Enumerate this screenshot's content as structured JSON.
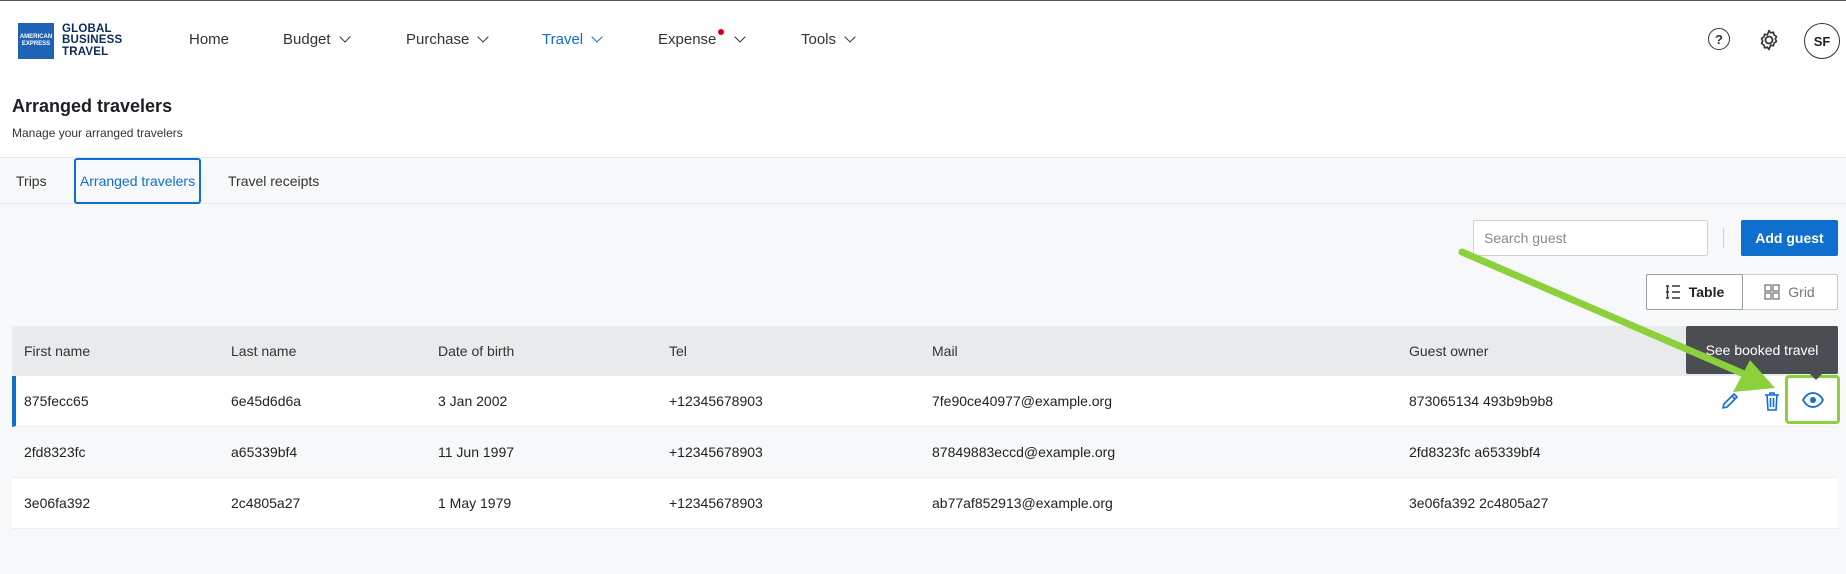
{
  "logo": {
    "badge": "AMERICAN EXPRESS",
    "line1": "GLOBAL",
    "line2": "BUSINESS",
    "line3": "TRAVEL"
  },
  "nav": {
    "items": [
      {
        "label": "Home"
      },
      {
        "label": "Budget"
      },
      {
        "label": "Purchase"
      },
      {
        "label": "Travel"
      },
      {
        "label": "Expense"
      },
      {
        "label": "Tools"
      }
    ],
    "help_icon": "?",
    "avatar": "SF"
  },
  "page": {
    "title": "Arranged travelers",
    "subtitle": "Manage your arranged travelers"
  },
  "tabs": [
    {
      "label": "Trips"
    },
    {
      "label": "Arranged travelers"
    },
    {
      "label": "Travel receipts"
    }
  ],
  "toolbar": {
    "search_placeholder": "Search guest",
    "add_label": "Add guest",
    "view_table": "Table",
    "view_grid": "Grid"
  },
  "table": {
    "headers": [
      "First name",
      "Last name",
      "Date of birth",
      "Tel",
      "Mail",
      "Guest owner"
    ],
    "rows": [
      [
        "875fecc65",
        "6e45d6d6a",
        "3 Jan 2002",
        "+12345678903",
        "7fe90ce40977@example.org",
        "873065134 493b9b9b8"
      ],
      [
        "2fd8323fc",
        "a65339bf4",
        "11 Jun 1997",
        "+12345678903",
        "87849883eccd@example.org",
        "2fd8323fc a65339bf4"
      ],
      [
        "3e06fa392",
        "2c4805a27",
        "1 May 1979",
        "+12345678903",
        "ab77af852913@example.org",
        "3e06fa392 2c4805a27"
      ]
    ]
  },
  "tooltip": "See booked travel",
  "colors": {
    "accent": "#0f6fcf",
    "highlight": "#8cd13b",
    "notification": "#d0021b"
  }
}
